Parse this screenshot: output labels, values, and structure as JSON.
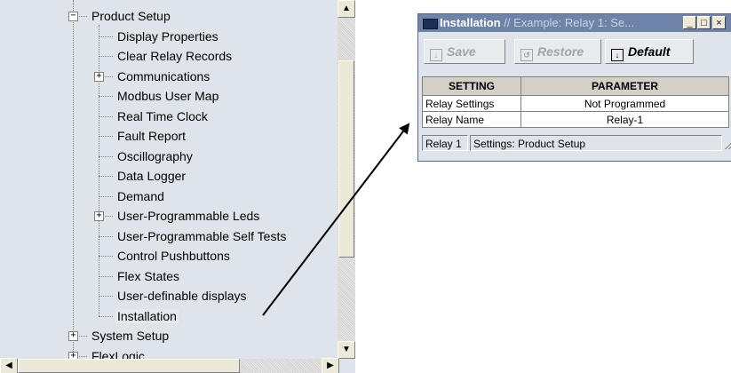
{
  "tree": {
    "items": [
      {
        "label": "Product Setup",
        "expander": "minus"
      },
      {
        "label": "Display Properties"
      },
      {
        "label": "Clear Relay Records"
      },
      {
        "label": "Communications",
        "expander": "plus"
      },
      {
        "label": "Modbus User Map"
      },
      {
        "label": "Real Time Clock"
      },
      {
        "label": "Fault Report"
      },
      {
        "label": "Oscillography"
      },
      {
        "label": "Data Logger"
      },
      {
        "label": "Demand"
      },
      {
        "label": "User-Programmable Leds",
        "expander": "plus"
      },
      {
        "label": "User-Programmable Self Tests"
      },
      {
        "label": "Control Pushbuttons"
      },
      {
        "label": "Flex States"
      },
      {
        "label": "User-definable displays"
      },
      {
        "label": "Installation",
        "selected": true
      },
      {
        "label": "System Setup",
        "expander": "plus"
      },
      {
        "label": "FlexLogic",
        "expander": "plus"
      }
    ],
    "scroll_up_glyph": "▲",
    "scroll_down_glyph": "▼",
    "scroll_left_glyph": "◀",
    "scroll_right_glyph": "▶"
  },
  "window": {
    "title": "Installation",
    "title_sub": "// Example: Relay 1: Se...",
    "minimize_glyph": "_",
    "maximize_glyph": "□",
    "close_glyph": "×",
    "toolbar": {
      "save_label": "Save",
      "restore_label": "Restore",
      "default_label": "Default"
    },
    "table": {
      "headers": [
        "SETTING",
        "PARAMETER"
      ],
      "rows": [
        [
          "Relay Settings",
          "Not Programmed"
        ],
        [
          "Relay Name",
          "Relay-1"
        ]
      ]
    },
    "status": {
      "relay": "Relay 1",
      "settings": "Settings: Product Setup"
    }
  },
  "colors": {
    "panel_bg": "#dfe3ea",
    "titlebar_bg": "#6f83a8",
    "arrow": "#000000"
  }
}
